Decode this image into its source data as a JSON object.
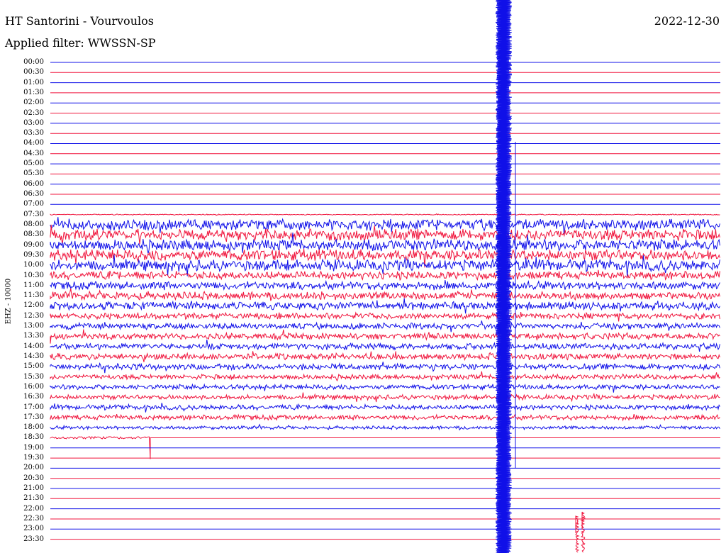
{
  "header": {
    "station": "HT Santorini - Vourvoulos",
    "filter": "Applied filter: WWSSN-SP",
    "date": "2022-12-30"
  },
  "axis": {
    "channel_label": "EHZ - 10000",
    "time_labels": [
      "00:00",
      "00:30",
      "01:00",
      "01:30",
      "02:00",
      "02:30",
      "03:00",
      "03:30",
      "04:00",
      "04:30",
      "05:00",
      "05:30",
      "06:00",
      "06:30",
      "07:00",
      "07:30",
      "08:00",
      "08:30",
      "09:00",
      "09:30",
      "10:00",
      "10:30",
      "11:00",
      "11:30",
      "12:00",
      "12:30",
      "13:00",
      "13:30",
      "14:00",
      "14:30",
      "15:00",
      "15:30",
      "16:00",
      "16:30",
      "17:00",
      "17:30",
      "18:00",
      "18:30",
      "19:00",
      "19:30",
      "20:00",
      "20:30",
      "21:00",
      "21:30",
      "22:00",
      "22:30",
      "23:00",
      "23:30"
    ]
  },
  "colors": {
    "trace_a": "#1010e8",
    "trace_b": "#f0143c"
  }
}
